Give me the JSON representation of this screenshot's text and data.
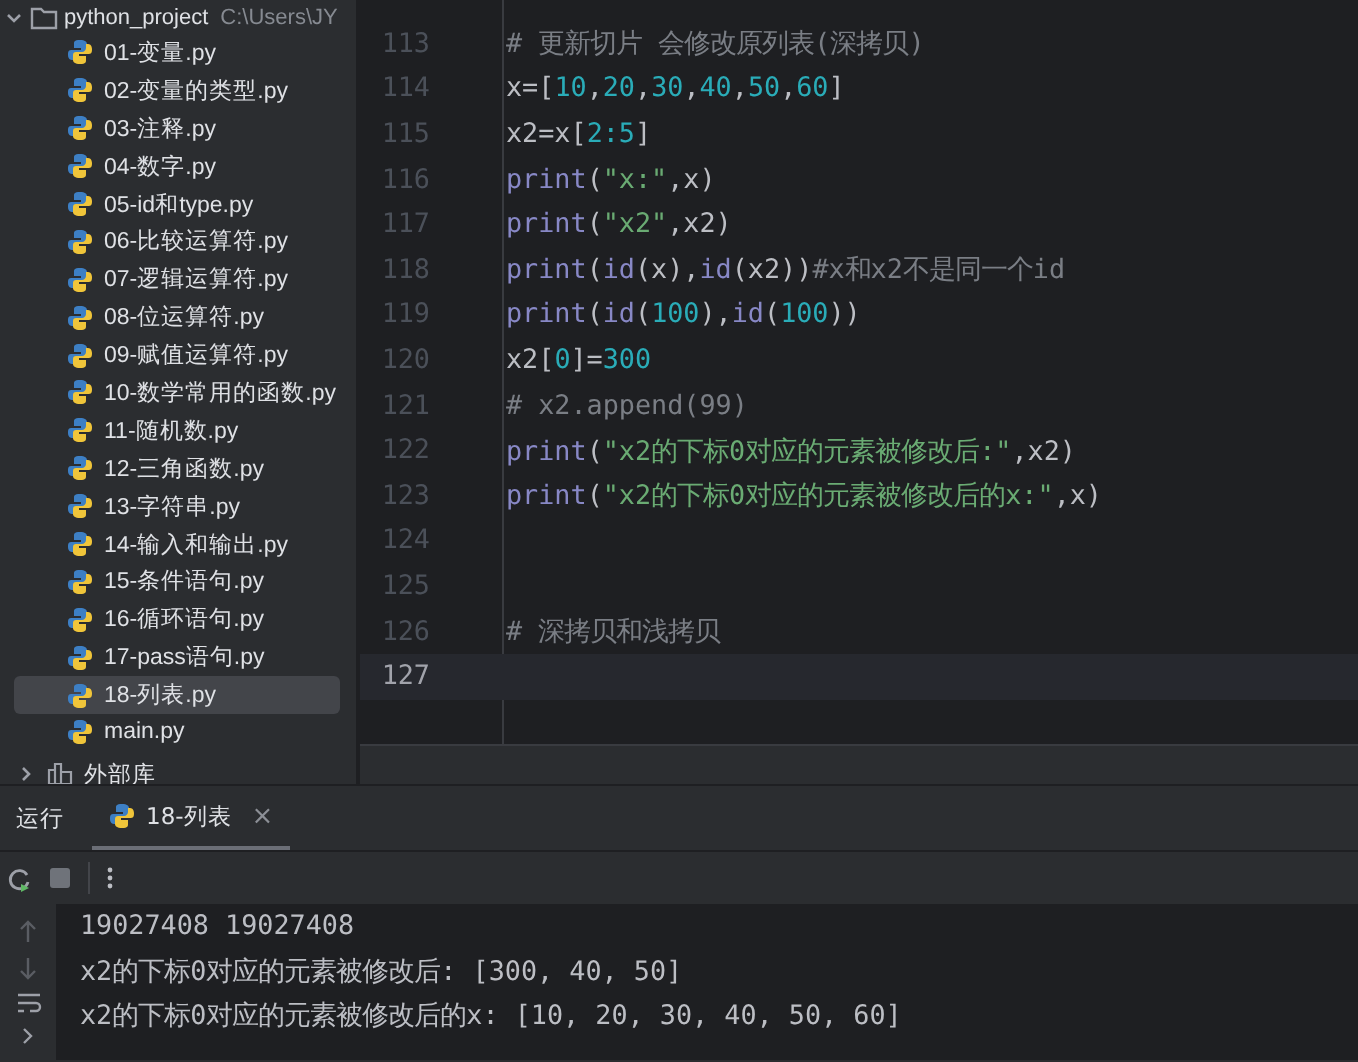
{
  "project_tree": {
    "root": {
      "name": "python_project",
      "path": "C:\\Users\\JY",
      "expanded": true
    },
    "files": [
      {
        "name": "01-变量.py",
        "selected": false
      },
      {
        "name": "02-变量的类型.py",
        "selected": false
      },
      {
        "name": "03-注释.py",
        "selected": false
      },
      {
        "name": "04-数字.py",
        "selected": false
      },
      {
        "name": "05-id和type.py",
        "selected": false
      },
      {
        "name": "06-比较运算符.py",
        "selected": false
      },
      {
        "name": "07-逻辑运算符.py",
        "selected": false
      },
      {
        "name": "08-位运算符.py",
        "selected": false
      },
      {
        "name": "09-赋值运算符.py",
        "selected": false
      },
      {
        "name": "10-数学常用的函数.py",
        "selected": false
      },
      {
        "name": "11-随机数.py",
        "selected": false
      },
      {
        "name": "12-三角函数.py",
        "selected": false
      },
      {
        "name": "13-字符串.py",
        "selected": false
      },
      {
        "name": "14-输入和输出.py",
        "selected": false
      },
      {
        "name": "15-条件语句.py",
        "selected": false
      },
      {
        "name": "16-循环语句.py",
        "selected": false
      },
      {
        "name": "17-pass语句.py",
        "selected": false
      },
      {
        "name": "18-列表.py",
        "selected": true
      },
      {
        "name": "main.py",
        "selected": false
      }
    ],
    "libraries": {
      "name": "外部库",
      "expanded": false
    }
  },
  "editor": {
    "lines": [
      {
        "number": "113",
        "current": false,
        "tokens": [
          {
            "kind": "comment",
            "text": "# 更新切片 会修改原列表(深拷贝)"
          }
        ]
      },
      {
        "number": "114",
        "current": false,
        "tokens": [
          {
            "kind": "plain",
            "text": "x=["
          },
          {
            "kind": "num",
            "text": "10"
          },
          {
            "kind": "plain",
            "text": ","
          },
          {
            "kind": "num",
            "text": "20"
          },
          {
            "kind": "plain",
            "text": ","
          },
          {
            "kind": "num",
            "text": "30"
          },
          {
            "kind": "plain",
            "text": ","
          },
          {
            "kind": "num",
            "text": "40"
          },
          {
            "kind": "plain",
            "text": ","
          },
          {
            "kind": "num",
            "text": "50"
          },
          {
            "kind": "plain",
            "text": ","
          },
          {
            "kind": "num",
            "text": "60"
          },
          {
            "kind": "plain",
            "text": "]"
          }
        ]
      },
      {
        "number": "115",
        "current": false,
        "tokens": [
          {
            "kind": "plain",
            "text": "x2=x["
          },
          {
            "kind": "num",
            "text": "2:5"
          },
          {
            "kind": "plain",
            "text": "]"
          }
        ]
      },
      {
        "number": "116",
        "current": false,
        "tokens": [
          {
            "kind": "fn",
            "text": "print"
          },
          {
            "kind": "plain",
            "text": "("
          },
          {
            "kind": "str",
            "text": "\"x:\""
          },
          {
            "kind": "plain",
            "text": ",x)"
          }
        ]
      },
      {
        "number": "117",
        "current": false,
        "tokens": [
          {
            "kind": "fn",
            "text": "print"
          },
          {
            "kind": "plain",
            "text": "("
          },
          {
            "kind": "str",
            "text": "\"x2\""
          },
          {
            "kind": "plain",
            "text": ",x2)"
          }
        ]
      },
      {
        "number": "118",
        "current": false,
        "tokens": [
          {
            "kind": "fn",
            "text": "print"
          },
          {
            "kind": "plain",
            "text": "("
          },
          {
            "kind": "fn",
            "text": "id"
          },
          {
            "kind": "plain",
            "text": "(x),"
          },
          {
            "kind": "fn",
            "text": "id"
          },
          {
            "kind": "plain",
            "text": "(x2))"
          },
          {
            "kind": "comment",
            "text": "#x和x2不是同一个id"
          }
        ]
      },
      {
        "number": "119",
        "current": false,
        "tokens": [
          {
            "kind": "fn",
            "text": "print"
          },
          {
            "kind": "plain",
            "text": "("
          },
          {
            "kind": "fn",
            "text": "id"
          },
          {
            "kind": "plain",
            "text": "("
          },
          {
            "kind": "num",
            "text": "100"
          },
          {
            "kind": "plain",
            "text": "),"
          },
          {
            "kind": "fn",
            "text": "id"
          },
          {
            "kind": "plain",
            "text": "("
          },
          {
            "kind": "num",
            "text": "100"
          },
          {
            "kind": "plain",
            "text": "))"
          }
        ]
      },
      {
        "number": "120",
        "current": false,
        "tokens": [
          {
            "kind": "plain",
            "text": "x2["
          },
          {
            "kind": "num",
            "text": "0"
          },
          {
            "kind": "plain",
            "text": "]="
          },
          {
            "kind": "num",
            "text": "300"
          }
        ]
      },
      {
        "number": "121",
        "current": false,
        "tokens": [
          {
            "kind": "comment",
            "text": "# x2.append(99)"
          }
        ]
      },
      {
        "number": "122",
        "current": false,
        "tokens": [
          {
            "kind": "fn",
            "text": "print"
          },
          {
            "kind": "plain",
            "text": "("
          },
          {
            "kind": "str",
            "text": "\"x2的下标0对应的元素被修改后:\""
          },
          {
            "kind": "plain",
            "text": ",x2)"
          }
        ]
      },
      {
        "number": "123",
        "current": false,
        "tokens": [
          {
            "kind": "fn",
            "text": "print"
          },
          {
            "kind": "plain",
            "text": "("
          },
          {
            "kind": "str",
            "text": "\"x2的下标0对应的元素被修改后的x:\""
          },
          {
            "kind": "plain",
            "text": ",x)"
          }
        ]
      },
      {
        "number": "124",
        "current": false
      },
      {
        "number": "125",
        "current": false
      },
      {
        "number": "126",
        "current": false,
        "tokens": [
          {
            "kind": "comment",
            "text": "# 深拷贝和浅拷贝"
          }
        ]
      },
      {
        "number": "127",
        "current": true
      }
    ]
  },
  "run_panel": {
    "title": "运行",
    "tabs": [
      {
        "label": "18-列表",
        "close": "×",
        "selected": true
      }
    ],
    "output": [
      "19027408 19027408",
      "x2的下标0对应的元素被修改后: [300, 40, 50]",
      "x2的下标0对应的元素被修改后的x: [10, 20, 30, 40, 50, 60]"
    ]
  }
}
